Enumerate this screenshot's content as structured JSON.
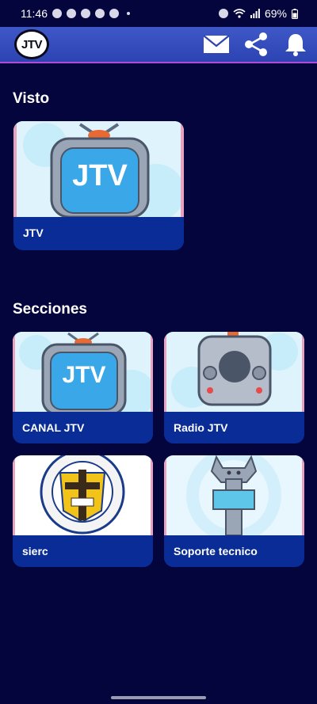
{
  "status_bar": {
    "time": "11:46",
    "battery": "69%",
    "icons": [
      "facebook-icon",
      "messages-icon",
      "android-icon",
      "robot-icon",
      "media-icon",
      "alarm-icon",
      "wifi-icon",
      "signal-icon",
      "battery-icon"
    ]
  },
  "app_bar": {
    "logo_text": "JTV",
    "actions": [
      "mail-icon",
      "share-icon",
      "bell-icon"
    ]
  },
  "visto": {
    "title": "Visto",
    "items": [
      {
        "label": "JTV",
        "thumb_text": "JTV"
      }
    ]
  },
  "secciones": {
    "title": "Secciones",
    "items": [
      {
        "label": "CANAL JTV",
        "thumb_text": "JTV"
      },
      {
        "label": "Radio JTV"
      },
      {
        "label": "sierc",
        "seal_text": "IGLESIA EVANGELICA Y REFORMADA"
      },
      {
        "label": "Soporte tecnico"
      }
    ]
  },
  "colors": {
    "background": "#05053d",
    "app_bar": "#3f58c8",
    "card_label": "#0a2c96",
    "accent_line": "#b14ad6"
  }
}
